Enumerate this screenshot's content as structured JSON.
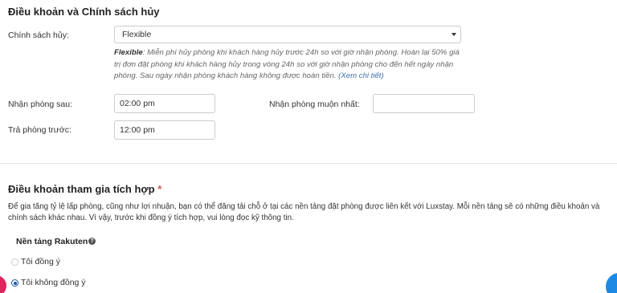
{
  "cancellation": {
    "title": "Điều khoản và Chính sách hủy",
    "policy_label": "Chính sách hủy:",
    "policy_value": "Flexible",
    "policy_desc_name": "Flexible",
    "policy_desc_text": ": Miễn phí hủy phòng khi khách hàng hủy trước 24h so với giờ nhận phòng. Hoàn lại 50% giá trị đơn đặt phòng khi khách hàng hủy trong vòng 24h so với giờ nhận phòng cho đến hết ngày nhận phòng. Sau ngày nhận phòng khách hàng không được hoàn tiền. ",
    "policy_desc_link": "(Xem chi tiết)",
    "checkin_after_label": "Nhận phòng sau:",
    "checkin_after_value": "02:00 pm",
    "checkin_latest_label": "Nhận phòng muộn nhất:",
    "checkin_latest_value": "",
    "checkout_before_label": "Trả phòng trước:",
    "checkout_before_value": "12:00 pm"
  },
  "integration": {
    "title": "Điều khoản tham gia tích hợp",
    "required_mark": "*",
    "paragraph": "Để gia tăng tỷ lệ lấp phòng, cũng như lợi nhuận, bạn có thể đăng tải chỗ ở tại các nền tảng đặt phòng được liên kết với Luxstay. Mỗi nền tảng sẽ có những điều khoản và chính sách khác nhau. Vì vậy, trước khi đồng ý tích hợp, vui lòng đọc kỹ thông tin.",
    "platform_label": "Nền tảng Rakuten",
    "help_icon": "question-circle-icon",
    "options": [
      {
        "label": "Tôi đồng ý",
        "selected": false
      },
      {
        "label": "Tôi không đồng ý",
        "selected": true
      }
    ]
  },
  "colors": {
    "accent": "#1a56a8",
    "required": "#d9534f",
    "link": "#3b6ea8"
  }
}
